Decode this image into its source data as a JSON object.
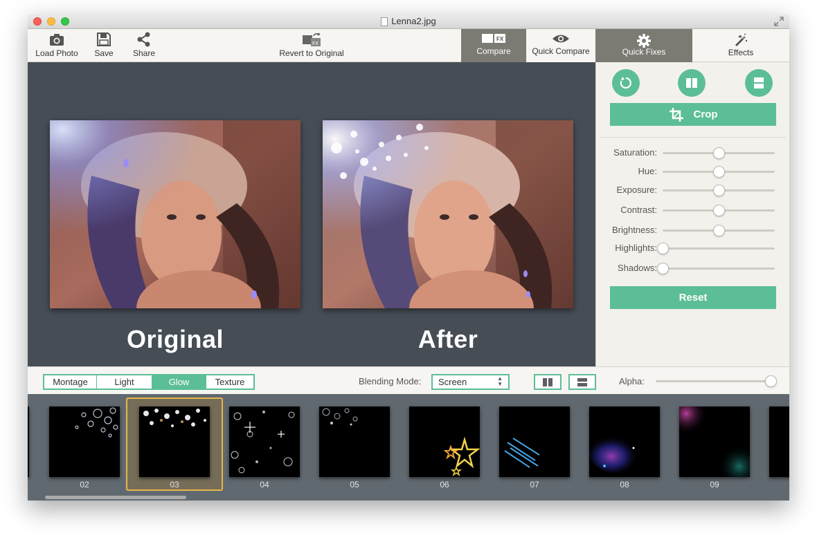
{
  "window": {
    "title": "Lenna2.jpg"
  },
  "toolbar": {
    "load_photo": "Load Photo",
    "save": "Save",
    "share": "Share",
    "revert": "Revert to Original",
    "tabs": [
      {
        "label": "Compare",
        "active": true
      },
      {
        "label": "Quick Compare",
        "active": false
      },
      {
        "label": "Quick Fixes",
        "active": true
      },
      {
        "label": "Effects",
        "active": false
      }
    ]
  },
  "preview": {
    "original_caption": "Original",
    "after_caption": "After"
  },
  "quick_fixes": {
    "crop_label": "Crop",
    "reset_label": "Reset",
    "adjustments": [
      {
        "label": "Saturation:",
        "value": 0.5
      },
      {
        "label": "Hue:",
        "value": 0.5
      },
      {
        "label": "Exposure:",
        "value": 0.5
      },
      {
        "label": "Contrast:",
        "value": 0.5
      },
      {
        "label": "Brightness:",
        "value": 0.5
      },
      {
        "label": "Highlights:",
        "value": 0.0
      },
      {
        "label": "Shadows:",
        "value": 0.0
      }
    ]
  },
  "effects_bar": {
    "categories": [
      "Montage",
      "Light",
      "Glow",
      "Texture"
    ],
    "active_category": "Glow",
    "blending_label": "Blending Mode:",
    "blending_value": "Screen",
    "alpha_label": "Alpha:",
    "alpha_value": 1.0
  },
  "thumbnails": [
    "02",
    "03",
    "04",
    "05",
    "06",
    "07",
    "08",
    "09"
  ],
  "selected_thumbnail": "03",
  "colors": {
    "accent": "#5cbe96",
    "preview_bg": "#464d55",
    "strip_bg": "#616970",
    "selection": "#e8b84a"
  }
}
